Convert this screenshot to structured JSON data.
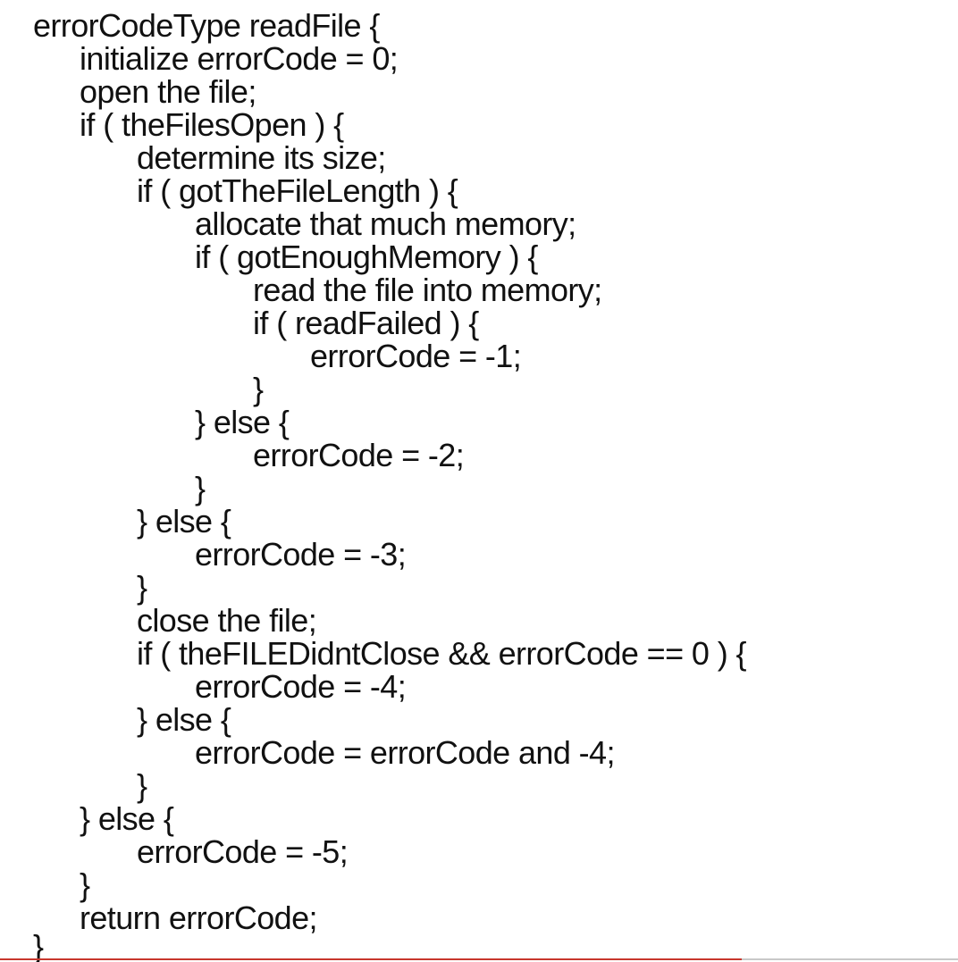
{
  "code": {
    "lines": [
      "errorCodeType readFile {",
      "initialize errorCode = 0;",
      "open the file;",
      "if ( theFilesOpen ) {",
      "determine its size;",
      "if ( gotTheFileLength ) {",
      "allocate that much memory;",
      "if ( gotEnoughMemory ) {",
      "read the file into memory;",
      "if ( readFailed ) {",
      "errorCode = -1;",
      "}",
      "} else {",
      "errorCode = -2;",
      "}",
      "} else {",
      "errorCode = -3;",
      "}",
      "close the file;",
      "if ( theFILEDidntClose && errorCode == 0 ) {",
      "errorCode = -4;",
      "} else {",
      "errorCode = errorCode and -4;",
      "}",
      "} else {",
      "errorCode = -5;",
      "}",
      "return errorCode;",
      "}"
    ]
  },
  "colors": {
    "text": "#111111",
    "background": "#ffffff",
    "accent_rule": "#c8372d"
  }
}
